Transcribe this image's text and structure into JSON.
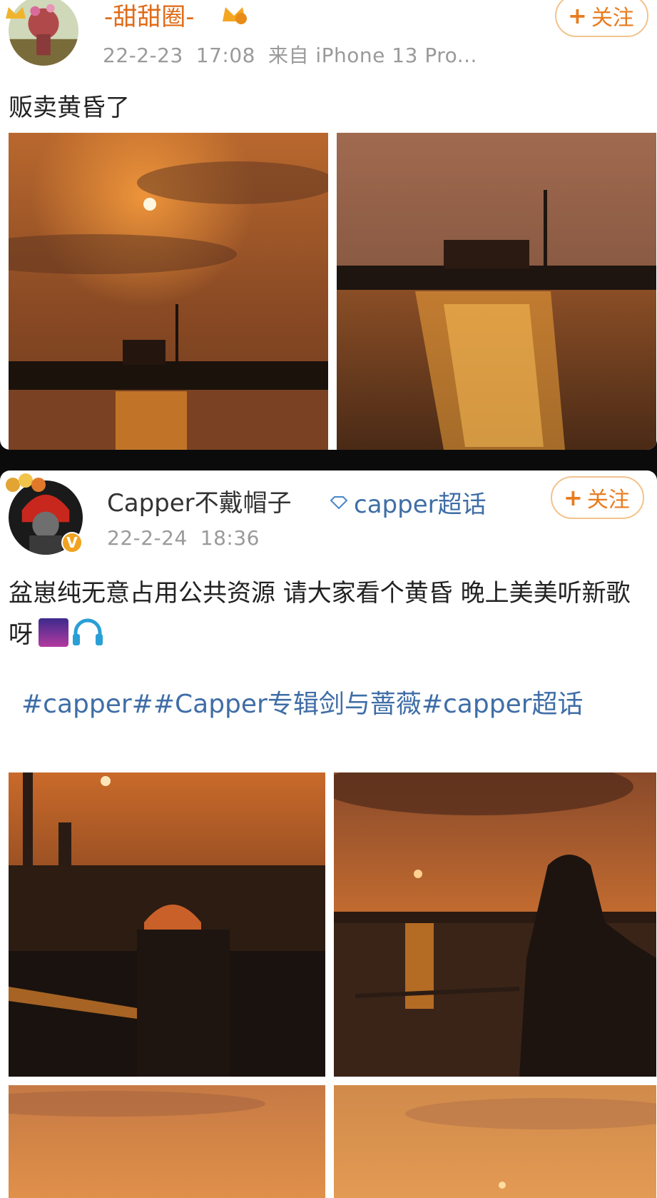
{
  "posts": [
    {
      "username": "-甜甜圈-",
      "date": "22-2-23",
      "time": "17:08",
      "source": "来自 iPhone 13 Pro...",
      "follow_label": "关注",
      "text": "贩卖黄昏了",
      "photos": [
        "sunset-sky",
        "river-reflection"
      ]
    },
    {
      "username": "Capper不戴帽子",
      "supertopic": "capper超话",
      "date": "22-2-24",
      "time": "18:36",
      "follow_label": "关注",
      "text": "盆崽纯无意占用公共资源 请大家看个黄昏 晚上美美听新歌呀",
      "topics": "#capper##Capper专辑剑与蔷薇#capper超话",
      "photos": [
        "person-by-lake",
        "person-photographing",
        "sky-bottom-left",
        "sky-bottom-right"
      ]
    }
  ],
  "icons": {
    "follow": "plus-icon",
    "supertopic": "diamond-icon",
    "verified": "yellow-v-badge",
    "emoji": [
      "city-night-emoji",
      "headphones-emoji"
    ]
  },
  "colors": {
    "username_accent": "#e06b17",
    "follow": "#e87b1e",
    "topic_link": "#3f6ea6",
    "meta_gray": "#9a9a9a"
  }
}
